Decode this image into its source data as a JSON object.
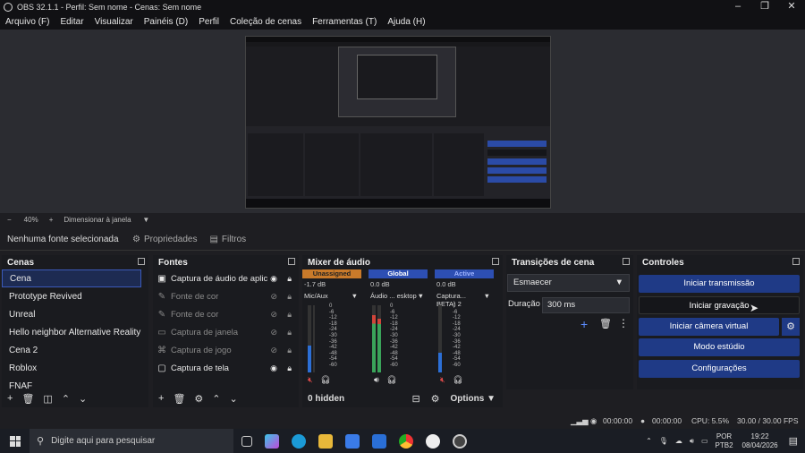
{
  "window": {
    "title": "OBS 32.1.1 - Perfil: Sem nome - Cenas: Sem nome"
  },
  "menu": [
    "Arquivo (F)",
    "Editar",
    "Visualizar",
    "Painéis (D)",
    "Perfil",
    "Coleção de cenas",
    "Ferramentas (T)",
    "Ajuda (H)"
  ],
  "zoom": {
    "minus": "−",
    "value": "40%",
    "plus": "+",
    "scale_mode": "Dimensionar à janela"
  },
  "source_toolbar": {
    "no_source": "Nenhuma fonte selecionada",
    "properties": "Propriedades",
    "filters": "Filtros"
  },
  "scenes": {
    "title": "Cenas",
    "items": [
      "Cena",
      "Prototype Revived",
      "Unreal",
      "Hello neighbor Alternative Reality",
      "Cena 2",
      "Roblox",
      "FNAF"
    ],
    "selected": "Cena"
  },
  "sources": {
    "title": "Fontes",
    "items": [
      {
        "name": "Captura de áudio de aplic",
        "icon": "audio-capture-icon",
        "dim": false
      },
      {
        "name": "Fonte de cor",
        "icon": "color-source-icon",
        "dim": true
      },
      {
        "name": "Fonte de cor",
        "icon": "color-source-icon",
        "dim": true
      },
      {
        "name": "Captura de janela",
        "icon": "window-capture-icon",
        "dim": true
      },
      {
        "name": "Captura de jogo",
        "icon": "game-capture-icon",
        "dim": true
      },
      {
        "name": "Captura de tela",
        "icon": "display-capture-icon",
        "dim": false
      }
    ]
  },
  "mixer": {
    "title": "Mixer de áudio",
    "channels": [
      {
        "tag": "Unassigned",
        "tag_color": "#c97a2a",
        "db": "-1.7 dB",
        "name": "Mic/Aux",
        "muted": true
      },
      {
        "tag": "Global",
        "tag_color": "#2d4fb3",
        "db": "0.0 dB",
        "name": "Áudio ... esktop",
        "muted": false
      },
      {
        "tag": "Active",
        "tag_color": "#2d4fb3",
        "db": "0.0 dB",
        "name": "Captura... BETA) 2",
        "muted": true
      }
    ],
    "scale": [
      "0",
      "-6",
      "-12",
      "-18",
      "-24",
      "-30",
      "-36",
      "-42",
      "-48",
      "-54",
      "-60"
    ],
    "hidden": "0 hidden",
    "options": "Options"
  },
  "transitions": {
    "title": "Transições de cena",
    "selected": "Esmaecer",
    "duration_label": "Duração",
    "duration": "300 ms"
  },
  "controls": {
    "title": "Controles",
    "buttons": [
      "Iniciar transmissão",
      "Iniciar gravação",
      "Iniciar câmera virtual",
      "Modo estúdio",
      "Configurações"
    ]
  },
  "status": {
    "stream_time": "00:00:00",
    "rec_time": "00:00:00",
    "cpu": "CPU: 5.5%",
    "fps": "30.00 / 30.00 FPS"
  },
  "taskbar": {
    "search_placeholder": "Digite aqui para pesquisar",
    "lang1": "POR",
    "lang2": "PTB2",
    "time": "19:22",
    "date": "08/04/2026"
  }
}
